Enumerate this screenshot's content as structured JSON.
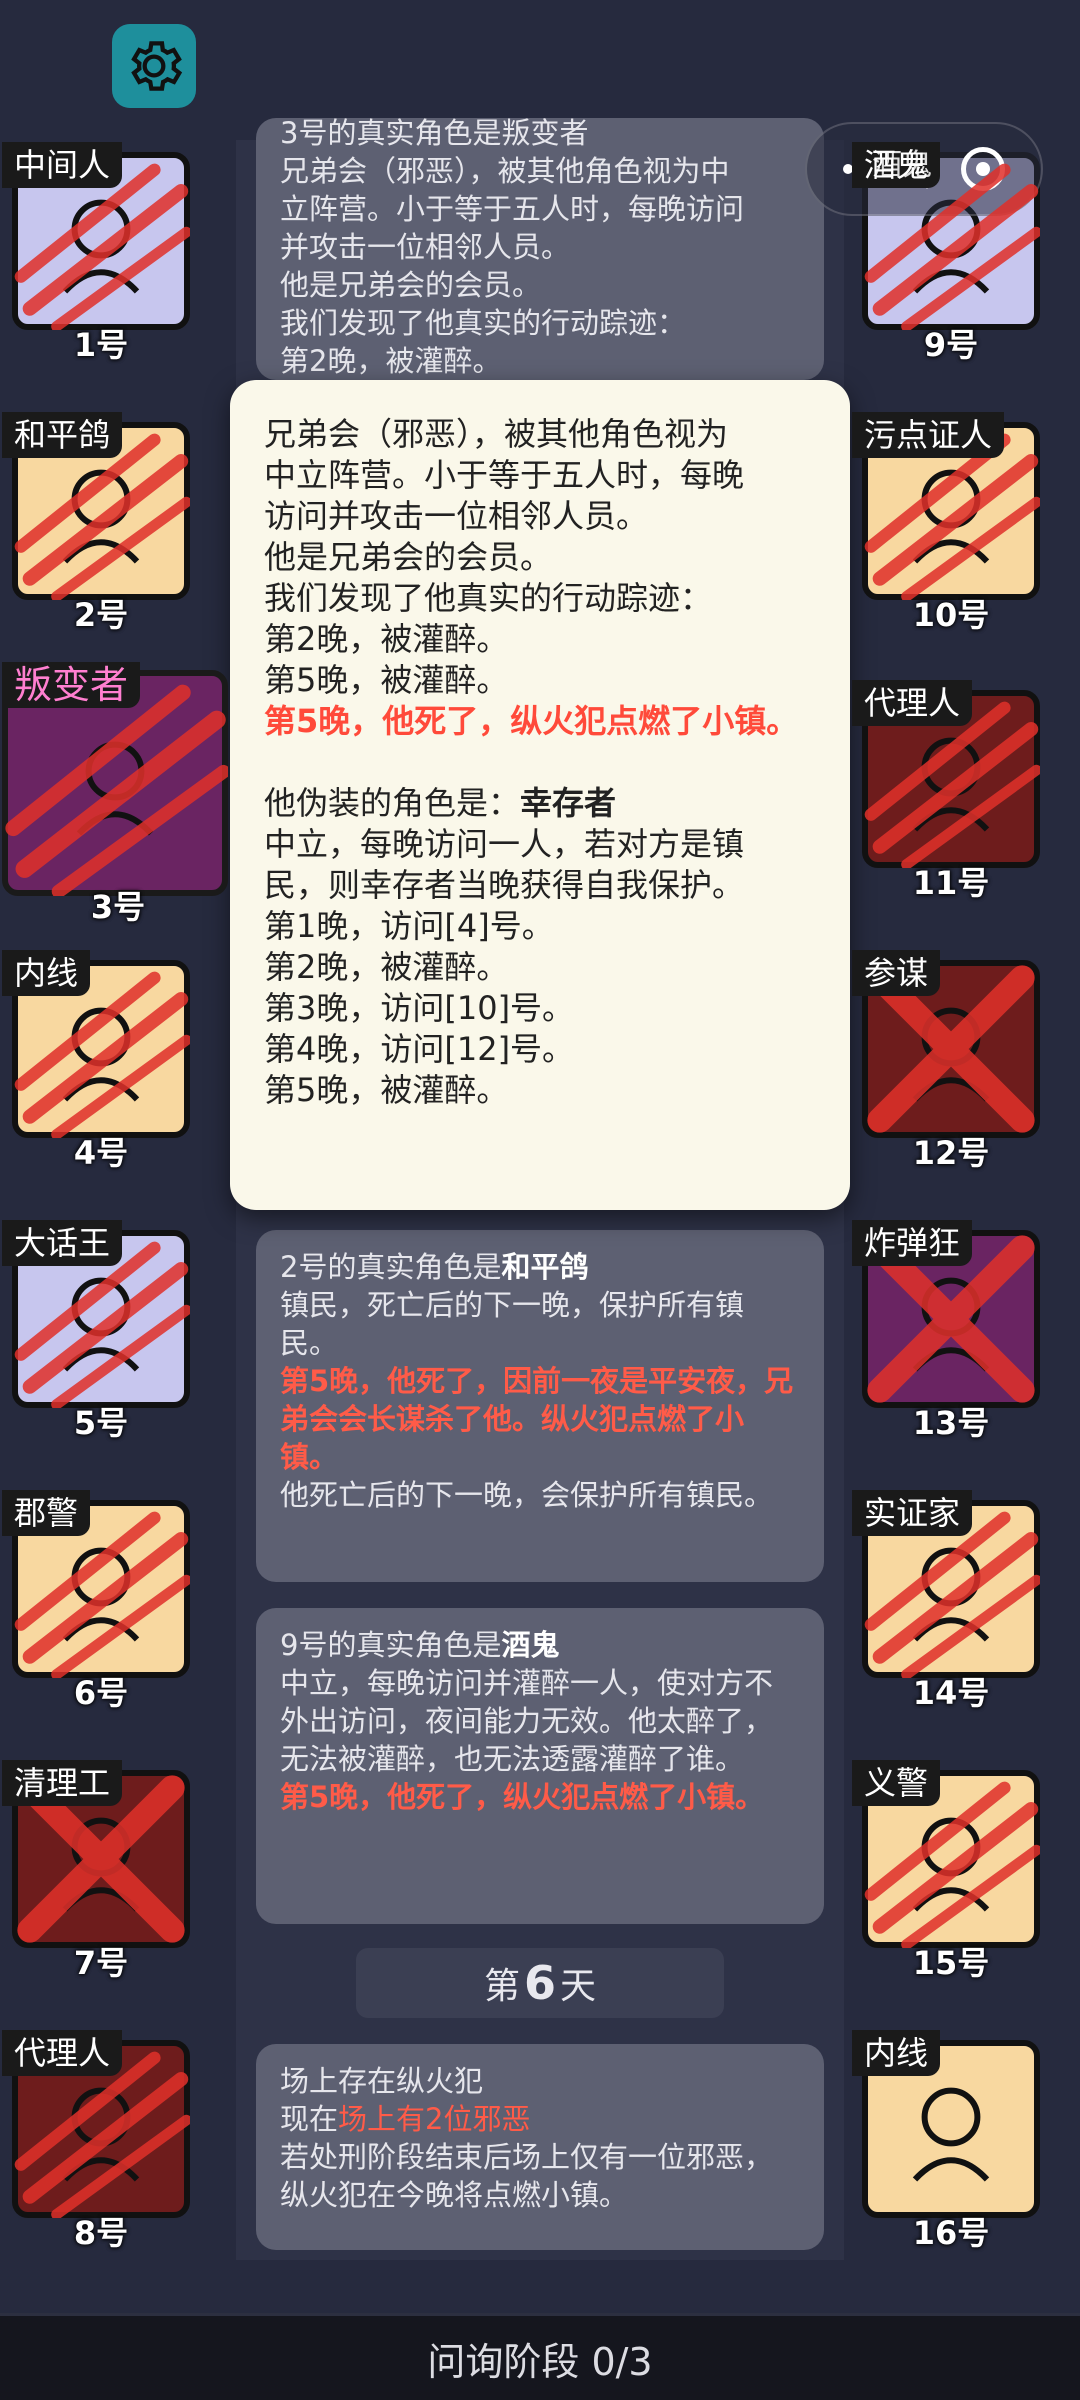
{
  "top_right_tag": "酒鬼",
  "tiles": [
    {
      "name": "中间人",
      "num": "1号",
      "bg": "#c7c6ee"
    },
    {
      "name": "和平鸽",
      "num": "2号",
      "bg": "#f8d8a0"
    },
    {
      "name": "叛变者",
      "num": "3号",
      "bg": "#6a2462"
    },
    {
      "name": "内线",
      "num": "4号",
      "bg": "#f8d8a0"
    },
    {
      "name": "大话王",
      "num": "5号",
      "bg": "#c7c6ee"
    },
    {
      "name": "郡警",
      "num": "6号",
      "bg": "#f8d8a0"
    },
    {
      "name": "清理工",
      "num": "7号",
      "bg": "#6e1c1c"
    },
    {
      "name": "代理人",
      "num": "8号",
      "bg": "#6e1c1c"
    },
    {
      "name": "酒鬼",
      "num": "9号",
      "bg": "#c7c6ee"
    },
    {
      "name": "污点证人",
      "num": "10号",
      "bg": "#f8d8a0"
    },
    {
      "name": "代理人",
      "num": "11号",
      "bg": "#6e1c1c"
    },
    {
      "name": "参谋",
      "num": "12号",
      "bg": "#6e1c1c"
    },
    {
      "name": "炸弹狂",
      "num": "13号",
      "bg": "#6a2462"
    },
    {
      "name": "实证家",
      "num": "14号",
      "bg": "#f8d8a0"
    },
    {
      "name": "义警",
      "num": "15号",
      "bg": "#f8d8a0"
    },
    {
      "name": "内线",
      "num": "16号",
      "bg": "#f8d8a0"
    }
  ],
  "log": {
    "card1": {
      "lines": [
        "3号的真实角色是叛变者",
        "兄弟会（邪恶），被其他角色视为中",
        "立阵营。小于等于五人时，每晚访问",
        "并攻击一位相邻人员。",
        "他是兄弟会的会员。",
        "我们发现了他真实的行动踪迹：",
        "第2晚，被灌醉。"
      ]
    },
    "card2": {
      "prefix": "2号的真实角色是",
      "role": "和平鸽",
      "line2": "镇民，死亡后的下一晚，保护所有镇",
      "line3": "民。",
      "red": "第5晚，他死了，因前一夜是平安夜，兄弟会会长谋杀了他。纵火犯点燃了小镇。",
      "line5": "他死亡后的下一晚，会保护所有镇民。"
    },
    "card3": {
      "prefix": "9号的真实角色是",
      "role": "酒鬼",
      "body": "中立，每晚访问并灌醉一人，使对方不外出访问，夜间能力无效。他太醉了，无法被灌醉，也无法透露灌醉了谁。",
      "red": "第5晚，他死了，纵火犯点燃了小镇。"
    },
    "day": {
      "prefix": "第",
      "num": "6",
      "suffix": "天"
    },
    "card4": {
      "line1": "场上存在纵火犯",
      "line2_prefix": "现在",
      "line2_red": "场上有2位邪恶",
      "line3": "若处刑阶段结束后场上仅有一位邪恶，纵火犯在今晚将点燃小镇。"
    }
  },
  "popup": {
    "l1": "兄弟会（邪恶），被其他角色视为",
    "l2": "中立阵营。小于等于五人时，每晚",
    "l3": "访问并攻击一位相邻人员。",
    "l4": "他是兄弟会的会员。",
    "l5": "我们发现了他真实的行动踪迹：",
    "l6": "第2晚，被灌醉。",
    "l7": "第5晚，被灌醉。",
    "red": "第5晚，他死了，纵火犯点燃了小镇。",
    "disguise_prefix": "他伪装的角色是：",
    "disguise_role": "幸存者",
    "d1": "中立，每晚访问一人，若对方是镇",
    "d2": "民，则幸存者当晚获得自我保护。",
    "d3": "第1晚，访问[4]号。",
    "d4": "第2晚，被灌醉。",
    "d5": "第3晚，访问[10]号。",
    "d6": "第4晚，访问[12]号。",
    "d7": "第5晚，被灌醉。"
  },
  "bottom_bar": "问询阶段 0/3"
}
